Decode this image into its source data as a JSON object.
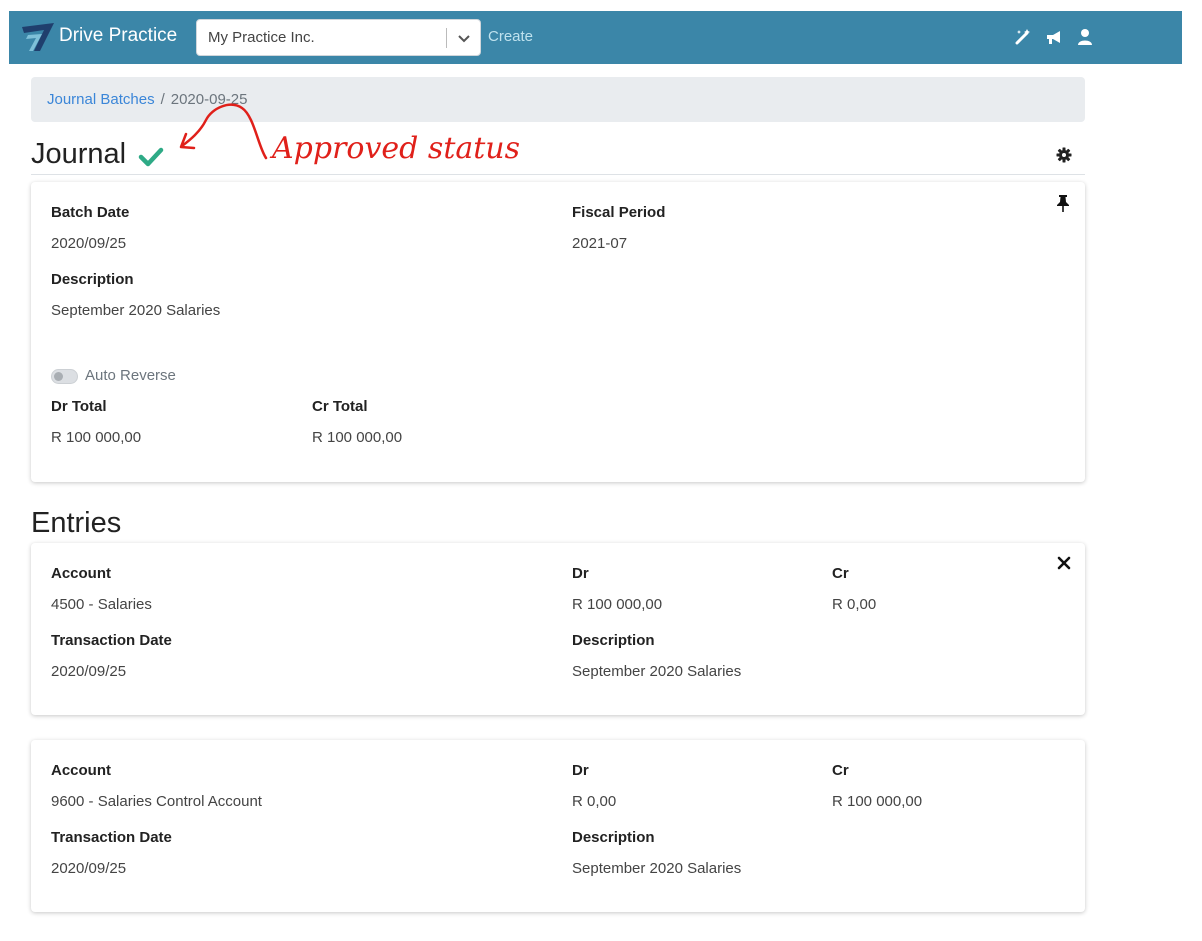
{
  "nav": {
    "brand": "Drive Practice",
    "company_value": "My Practice Inc.",
    "create_label": "Create"
  },
  "breadcrumb": {
    "link": "Journal Batches",
    "separator": "/",
    "current": "2020-09-25"
  },
  "page": {
    "title": "Journal",
    "annotation": "Approved status"
  },
  "journal": {
    "batch_date_label": "Batch Date",
    "batch_date_value": "2020/09/25",
    "fiscal_period_label": "Fiscal Period",
    "fiscal_period_value": "2021-07",
    "description_label": "Description",
    "description_value": "September 2020 Salaries",
    "auto_reverse_label": "Auto Reverse",
    "dr_total_label": "Dr Total",
    "dr_total_value": "R 100 000,00",
    "cr_total_label": "Cr Total",
    "cr_total_value": "R 100 000,00"
  },
  "entries_title": "Entries",
  "entries": [
    {
      "account_label": "Account",
      "account_value": "4500 - Salaries",
      "dr_label": "Dr",
      "dr_value": "R 100 000,00",
      "cr_label": "Cr",
      "cr_value": "R 0,00",
      "transaction_date_label": "Transaction Date",
      "transaction_date_value": "2020/09/25",
      "description_label": "Description",
      "description_value": "September 2020 Salaries"
    },
    {
      "account_label": "Account",
      "account_value": "9600 - Salaries Control Account",
      "dr_label": "Dr",
      "dr_value": "R 0,00",
      "cr_label": "Cr",
      "cr_value": "R 100 000,00",
      "transaction_date_label": "Transaction Date",
      "transaction_date_value": "2020/09/25",
      "description_label": "Description",
      "description_value": "September 2020 Salaries"
    }
  ],
  "icons": {
    "brand_logo": "logo-icon",
    "company_dropdown": "chevron-down-icon",
    "magic": "magic-wand-icon",
    "announcements": "megaphone-icon",
    "user": "user-icon",
    "status": "check-icon",
    "settings": "gear-icon",
    "pin": "pin-icon",
    "close": "close-icon"
  },
  "colors": {
    "navbar": "#3b86a8",
    "link": "#3b86d8",
    "approved_check": "#2eaa86",
    "annotation": "#e0201a"
  },
  "state": {
    "auto_reverse_enabled": false
  }
}
